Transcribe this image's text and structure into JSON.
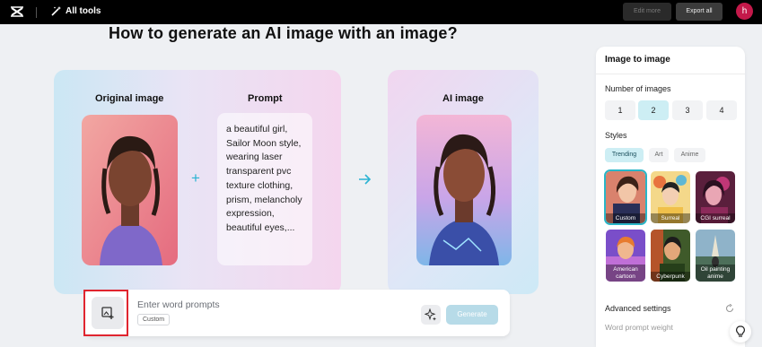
{
  "topbar": {
    "tools_label": "All tools",
    "edit_more_label": "Edit more",
    "export_all_label": "Export all",
    "avatar_initial": "h"
  },
  "main": {
    "title": "How to generate an AI image with an image?",
    "original_title": "Original image",
    "prompt_title": "Prompt",
    "ai_title": "AI image",
    "prompt_text": "a beautiful girl, Sailor Moon style, wearing laser transparent pvc texture clothing, prism, melancholy expression, beautiful eyes,..."
  },
  "input_bar": {
    "placeholder": "Enter word prompts",
    "chip_label": "Custom",
    "generate_label": "Generate"
  },
  "panel": {
    "title": "Image to image",
    "number_label": "Number of images",
    "number_options": [
      "1",
      "2",
      "3",
      "4"
    ],
    "selected_number": "2",
    "styles_label": "Styles",
    "style_tabs": [
      "Trending",
      "Art",
      "Anime"
    ],
    "active_tab": "Trending",
    "styles": [
      {
        "label": "Custom",
        "selected": true
      },
      {
        "label": "Surreal",
        "selected": false
      },
      {
        "label": "CGI surreal",
        "selected": false
      },
      {
        "label": "American cartoon",
        "selected": false
      },
      {
        "label": "Cyberpunk",
        "selected": false
      },
      {
        "label": "Oil painting anime",
        "selected": false
      }
    ],
    "advanced_label": "Advanced settings",
    "weight_label": "Word prompt weight"
  },
  "colors": {
    "accent": "#29b6c8",
    "highlight": "#e0252f",
    "topbar": "#000000"
  }
}
